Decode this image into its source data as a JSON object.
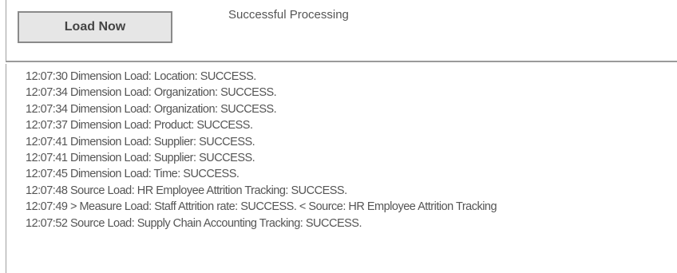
{
  "toolbar": {
    "load_button_label": "Load Now",
    "status_text": "Successful Processing"
  },
  "log": {
    "lines": [
      "12:07:30 Dimension Load: Location: SUCCESS.",
      "12:07:34 Dimension Load: Organization: SUCCESS.",
      "12:07:34 Dimension Load: Organization: SUCCESS.",
      "12:07:37 Dimension Load: Product: SUCCESS.",
      "12:07:41 Dimension Load: Supplier: SUCCESS.",
      "12:07:41 Dimension Load: Supplier: SUCCESS.",
      "12:07:45 Dimension Load: Time: SUCCESS.",
      "12:07:48 Source Load: HR Employee Attrition Tracking: SUCCESS.",
      "12:07:49 > Measure Load: Staff Attrition rate: SUCCESS. < Source: HR Employee Attrition Tracking",
      "12:07:52 Source Load: Supply Chain Accounting Tracking: SUCCESS."
    ]
  }
}
